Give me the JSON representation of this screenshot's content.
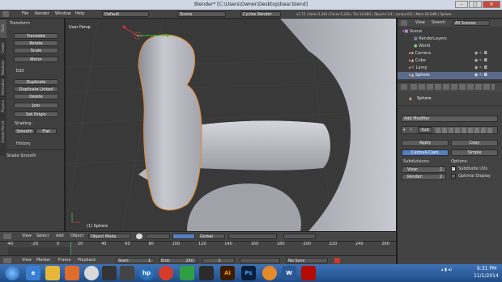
{
  "window": {
    "title": "Blender* [C:\\Users\\Owner\\Desktop\\bear.blend]",
    "min": "–",
    "max": "□",
    "close": "✕"
  },
  "info_header": {
    "menus": [
      "File",
      "Render",
      "Window",
      "Help"
    ],
    "layout": "Default",
    "scene": "Scene",
    "engine": "Cycles Render",
    "stats": "v2.72 | Verts:5,344 | Faces:5,226 | Tris:10,480 | Objects:1/4 | Lamps:0/1 | Mem:18.04M | Sphere"
  },
  "shelf": {
    "tabs": [
      "Tools",
      "Create",
      "Relations",
      "Animation",
      "Physics",
      "Grease Pencil"
    ],
    "transform_header": "Transform",
    "transform": [
      "Translate",
      "Rotate",
      "Scale"
    ],
    "mirror": "Mirror",
    "edit_header": "Edit",
    "edit": [
      "Duplicate",
      "Duplicate Linked",
      "Delete"
    ],
    "join": "Join",
    "set_origin": "Set Origin",
    "shading_label": "Shading:",
    "smooth": "Smooth",
    "flat": "Flat",
    "history_header": "History",
    "shade_smooth": "Shade Smooth"
  },
  "viewport": {
    "view_label": "User Persp",
    "object_label": "(1) Sphere"
  },
  "view_header": {
    "menus": [
      "View",
      "Select",
      "Add",
      "Object"
    ],
    "mode": "Object Mode",
    "orientation": "Global"
  },
  "timeline": {
    "ticks": [
      "-40",
      "-20",
      "0",
      "20",
      "40",
      "60",
      "80",
      "100",
      "120",
      "140",
      "160",
      "180",
      "200",
      "220",
      "240",
      "260"
    ],
    "menus": [
      "View",
      "Marker",
      "Frame",
      "Playback"
    ],
    "start": "Start:",
    "start_val": "1",
    "end": "End:",
    "end_val": "250",
    "current": "1",
    "sync": "No Sync"
  },
  "outliner": {
    "menus": [
      "View",
      "Search",
      "All Scenes"
    ],
    "items": [
      {
        "name": "Scene",
        "icon": "scene-icon"
      },
      {
        "name": "RenderLayers",
        "icon": "renderlayers-icon"
      },
      {
        "name": "World",
        "icon": "world-icon"
      },
      {
        "name": "Camera",
        "icon": "camera-icon"
      },
      {
        "name": "Cube",
        "icon": "mesh-icon"
      },
      {
        "name": "Lamp",
        "icon": "lamp-icon"
      },
      {
        "name": "Sphere",
        "icon": "mesh-icon"
      }
    ]
  },
  "properties": {
    "object_name": "Sphere",
    "add_modifier": "Add Modifier",
    "modifier_name": "Sub",
    "apply": "Apply",
    "copy": "Copy",
    "catmull": "Catmull-Clark",
    "simple": "Simple",
    "subdivisions": "Subdivisions:",
    "view_label": "View:",
    "view_val": "2",
    "render_label": "Render:",
    "render_val": "2",
    "options": "Options:",
    "subdivide_uvs": "Subdivide UVs",
    "optimal_display": "Optimal Display"
  },
  "taskbar": {
    "time": "6:31 PM",
    "date": "11/1/2014",
    "icons": [
      "ie-icon",
      "folder-icon",
      "firefox-icon",
      "chrome-icon",
      "app-icon",
      "steam-icon",
      "hp-icon",
      "media-icon",
      "office-icon",
      "xbox-icon",
      "illustrator-icon",
      "photoshop-icon",
      "blender-icon",
      "word-icon",
      "acrobat-icon"
    ]
  },
  "colors": {
    "accent_orange": "#e58a2a",
    "selection_blue": "#5680c2",
    "taskbar_blue": "#2a5a9a"
  }
}
